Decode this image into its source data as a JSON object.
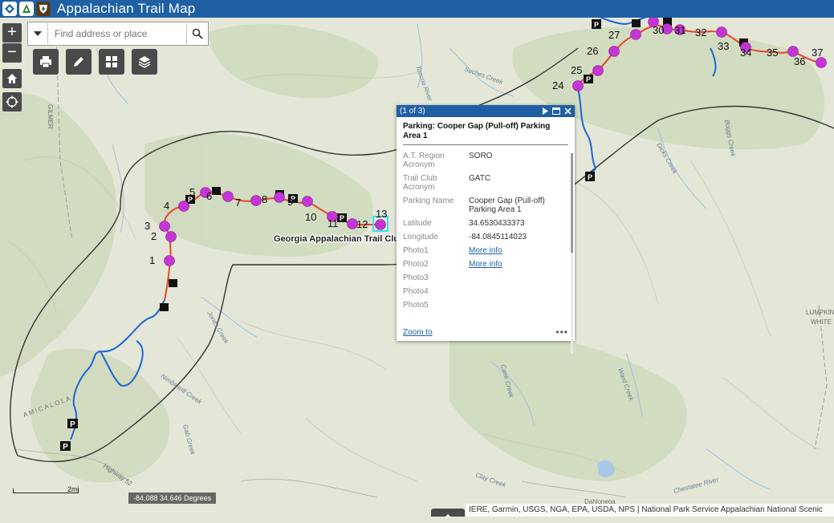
{
  "header": {
    "title": "Appalachian Trail Map",
    "logos": [
      "at-diamond-logo",
      "atc-leaf-logo",
      "nps-arrowhead-logo"
    ]
  },
  "search": {
    "placeholder": "Find address or place"
  },
  "map_controls": {
    "zoom_in": "+",
    "zoom_out": "−",
    "home_icon": "home-icon",
    "locate_icon": "locate-icon",
    "tools": [
      "print-icon",
      "edit-icon",
      "basemap-gallery-icon",
      "layers-icon"
    ]
  },
  "map_labels": {
    "club_label": "Georgia Appalachian Trail Club",
    "stops": [
      "1",
      "2",
      "3",
      "4",
      "5",
      "6",
      "7",
      "8",
      "9",
      "10",
      "11",
      "12",
      "13",
      "24",
      "25",
      "26",
      "27",
      "30",
      "31",
      "32",
      "33",
      "34",
      "35",
      "36",
      "37"
    ],
    "places": [
      "GILMER",
      "LUMPKIN",
      "WHITE",
      "Dahlonega",
      "AMICALOLA"
    ],
    "waterways": [
      "Toccoa River",
      "Suches Creek",
      "Jones Creek",
      "Nimblewill Creek",
      "Cane Creek",
      "Ward Creek",
      "Clay Creek",
      "Chestatee River",
      "Dicks Creek",
      "Boggs Creek",
      "Gab Creek",
      "Highway 52"
    ]
  },
  "popup": {
    "counter": "(1 of 3)",
    "title": "Parking: Cooper Gap (Pull-off) Parking Area 1",
    "fields": [
      {
        "label": "A.T. Region Acronym",
        "value": "SORO"
      },
      {
        "label": "Trail Club Acronym",
        "value": "GATC"
      },
      {
        "label": "Parking Name",
        "value": "Cooper Gap (Pull-off) Parking Area 1"
      },
      {
        "label": "Latitude",
        "value": "34.6530433373"
      },
      {
        "label": "Longitude",
        "value": "-84.0845114023"
      },
      {
        "label": "Photo1",
        "value": "More info"
      },
      {
        "label": "Photo2",
        "value": "More info"
      },
      {
        "label": "Photo3",
        "value": ""
      },
      {
        "label": "Photo4",
        "value": ""
      },
      {
        "label": "Photo5",
        "value": ""
      }
    ],
    "zoom_to": "Zoom to",
    "more": "•••"
  },
  "coordinates": "-84.088 34.646 Degrees",
  "scale": "2mi",
  "attribution": "IERE, Garmin, USGS, NGA, EPA, USDA, NPS | National Park Service Appalachian National Scenic",
  "colors": {
    "header": "#1f5fa3",
    "trail_primary": "#e8442a",
    "trail_secondary": "#1e64d8",
    "stop_marker": "#c535d6",
    "buffer_line": "#333333"
  }
}
